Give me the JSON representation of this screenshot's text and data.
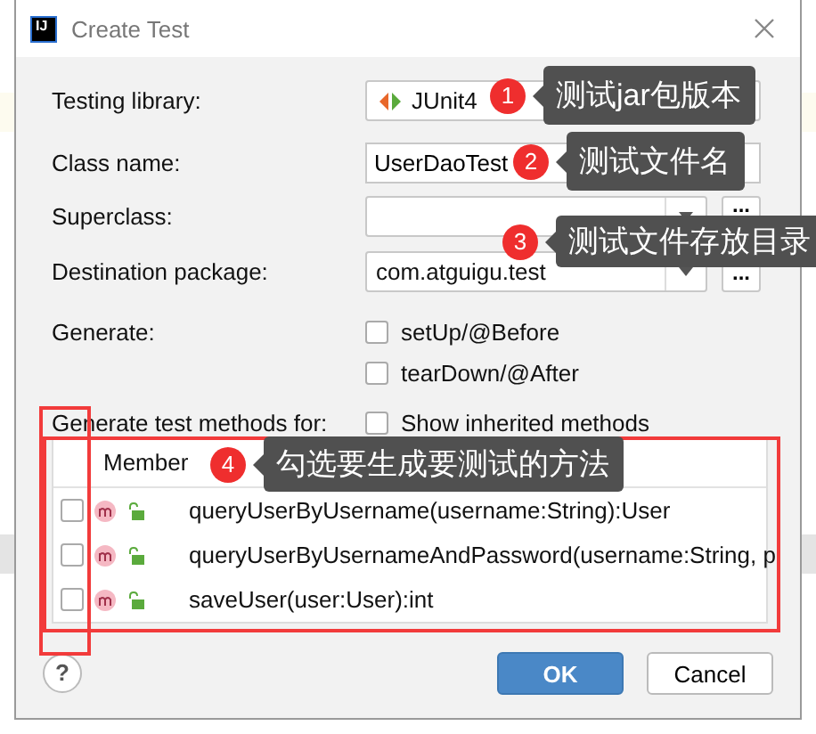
{
  "window": {
    "icon_text": "IJ",
    "title": "Create Test"
  },
  "fields": [
    {
      "label": "Testing library:",
      "kind": "library",
      "value": "JUnit4"
    },
    {
      "label": "Class name:",
      "kind": "text",
      "value": "UserDaoTest"
    },
    {
      "label": "Superclass:",
      "kind": "combo",
      "browse": "..."
    },
    {
      "label": "Destination package:",
      "kind": "combo",
      "value": "com.atguigu.test",
      "browse": "..."
    }
  ],
  "generate": {
    "label": "Generate:",
    "options": [
      {
        "label": "setUp/@Before",
        "checked": false
      },
      {
        "label": "tearDown/@After",
        "checked": false
      }
    ]
  },
  "methods": {
    "label": "Generate test methods for:",
    "show_inherited": {
      "label": "Show inherited methods",
      "checked": false
    },
    "header": "Member",
    "rows": [
      {
        "signature": "queryUserByUsername(username:String):User",
        "checked": false
      },
      {
        "signature": "queryUserByUsernameAndPassword(username:String, p",
        "checked": false
      },
      {
        "signature": "saveUser(user:User):int",
        "checked": false
      }
    ]
  },
  "help": "?",
  "buttons": [
    {
      "label": "OK",
      "primary": true
    },
    {
      "label": "Cancel",
      "primary": false
    }
  ],
  "annotations": [
    {
      "number": "1",
      "text": "测试jar包版本"
    },
    {
      "number": "2",
      "text": "测试文件名"
    },
    {
      "number": "3",
      "text": "测试文件存放目录"
    },
    {
      "number": "4",
      "text": "勾选要生成要测试的方法"
    }
  ]
}
